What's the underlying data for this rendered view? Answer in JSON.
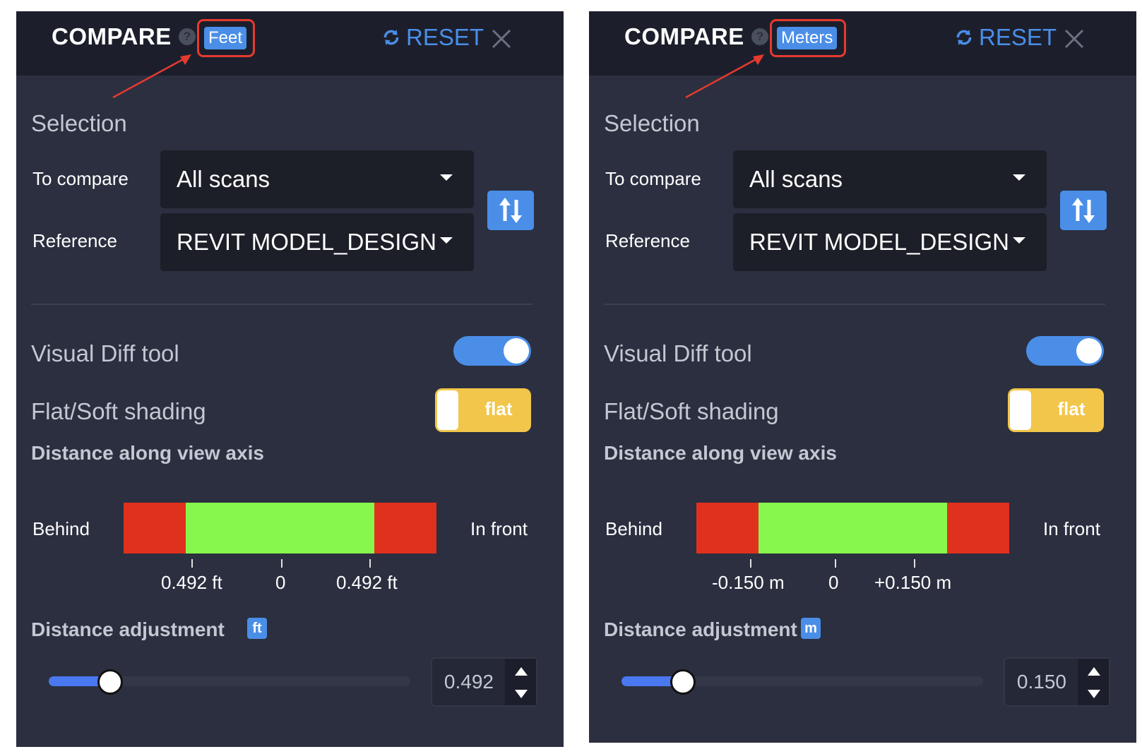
{
  "colors": {
    "accent": "#4a8ee8",
    "toggle_yellow": "#f2c64a",
    "out_of_range": "#e0311f",
    "in_range": "#88f74d",
    "highlight": "#e63a2e"
  },
  "panels": [
    {
      "title": "COMPARE",
      "help_icon": "?",
      "unit_badge": "Feet",
      "reset_label": "RESET",
      "selection_label": "Selection",
      "to_compare_label": "To compare",
      "to_compare_value": "All scans",
      "reference_label": "Reference",
      "reference_value": "REVIT MODEL_DESIGN",
      "visual_diff_label": "Visual Diff tool",
      "visual_diff_on": true,
      "shading_label": "Flat/Soft shading",
      "shading_value": "flat",
      "distance_axis_label": "Distance along view axis",
      "behind_label": "Behind",
      "in_front_label": "In front",
      "tick_left": "0.492 ft",
      "tick_center": "0",
      "tick_right": "0.492 ft",
      "distance_adjustment_label": "Distance adjustment",
      "unit_icon": "ft",
      "adjustment_value": "0.492",
      "slider_fraction": 0.17
    },
    {
      "title": "COMPARE",
      "help_icon": "?",
      "unit_badge": "Meters",
      "reset_label": "RESET",
      "selection_label": "Selection",
      "to_compare_label": "To compare",
      "to_compare_value": "All scans",
      "reference_label": "Reference",
      "reference_value": "REVIT MODEL_DESIGN",
      "visual_diff_label": "Visual Diff tool",
      "visual_diff_on": true,
      "shading_label": "Flat/Soft shading",
      "shading_value": "flat",
      "distance_axis_label": "Distance along view axis",
      "behind_label": "Behind",
      "in_front_label": "In front",
      "tick_left": "-0.150 m",
      "tick_center": "0",
      "tick_right": "+0.150 m",
      "distance_adjustment_label": "Distance adjustment",
      "unit_icon": "m",
      "adjustment_value": "0.150",
      "slider_fraction": 0.17
    }
  ]
}
